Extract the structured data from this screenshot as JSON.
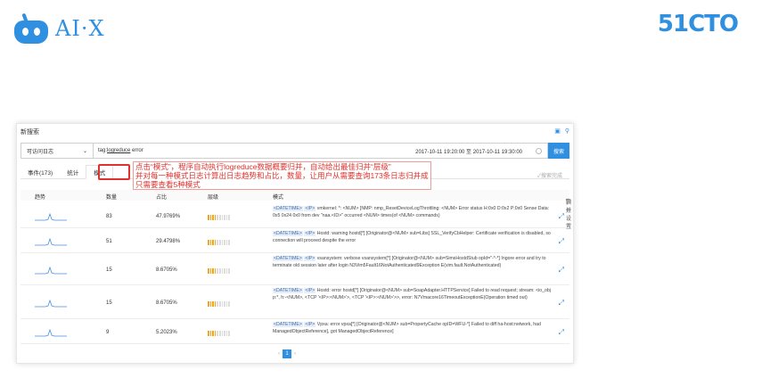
{
  "slide": {
    "brand_left": "AI·X",
    "brand_right": "51CTO"
  },
  "panel": {
    "title": "新搜索",
    "logstore_select": "可访问日志",
    "query_prefix": "tag:",
    "query_term": "logreduce",
    "query_suffix": " error",
    "time_range": "2017-10-11 19:20:00 至 2017-10-11 19:30:00",
    "search_button": "搜索",
    "tabs": [
      {
        "label": "事件(173)"
      },
      {
        "label": "统计"
      },
      {
        "label": "模式"
      }
    ],
    "search_done": "✓搜索完成",
    "annotation_lines": [
      "点击“模式”，程序自动执行logreduce数据概要归并，自动给出最佳归并“层级”",
      "并对每一种模式日志计算出日志趋势和占比，数量，让用户从需要查询173条日志归并成",
      "只需要查看5种模式"
    ],
    "columns": {
      "trend": "趋势",
      "count": "数量",
      "ratio": "占比",
      "level": "层级",
      "pattern": "模式"
    },
    "tools": {
      "settings": "归并设置",
      "expand_all": "归并",
      "back": "后退"
    },
    "rows": [
      {
        "count": "83",
        "ratio": "47.9769%",
        "level": 4,
        "p1": "<DATETIME>",
        "p2": "<IP>",
        "pattern": " vmkernel: *: <NUM> ]NMP: nmp_ResetDeviceLogThrottling: <NUM> Error status H:0x0 D:0x2 P:0x0 Sense Data: 0x5 0x24 0x0 from dev \"naa.<ID>\" occurred <NUM> times(of <NUM> commands)"
      },
      {
        "count": "51",
        "ratio": "29.4798%",
        "level": 4,
        "p1": "<DATETIME>",
        "p2": "<IP>",
        "pattern": " Hostd: warning hostd[*] [Originator@<NUM> sub=Libs] SSL_VerifyCbHelper: Certificate verification is disabled, so connection will proceed despite the error"
      },
      {
        "count": "15",
        "ratio": "8.6705%",
        "level": 4,
        "p1": "<DATETIME>",
        "p2": "<IP>",
        "pattern": " vsansystem: verbose vsansystem[*] [Originator@<NUM> sub=SimsHostdStub opId=\"-*-*] Ingore error and try to terminate old session later after login N3Vim5Fault16NotAuthenticated9Exception E(vim.fault.NotAuthenticated)"
      },
      {
        "count": "15",
        "ratio": "8.6705%",
        "level": 4,
        "p1": "<DATETIME>",
        "p2": "<IP>",
        "pattern": " Hostd: error hostd[*] [Originator@<NUM> sub=SoapAdapter.HTTPService] Failed to read request; stream: <io_obj p:*, h:-<NUM>, <TCP '<IP>:<NUM>'>, <TCP '<IP>:<NUM>'>>, error: N7Vmacore16TimeoutExceptionE(Operation timed out)"
      },
      {
        "count": "9",
        "ratio": "5.2023%",
        "level": 4,
        "p1": "<DATETIME>",
        "p2": "<IP>",
        "pattern": " Vpxa: error vpxa[*] [Originator@<NUM> sub=PropertyCache opID=WFU-*] Failed to diff ha-host:network, had ManagedObjectReference], got ManagedObjectReference]"
      }
    ],
    "pager": {
      "prev": "‹",
      "current": "1",
      "next": "›"
    }
  },
  "colors": {
    "accent": "#2f8fe0",
    "annotation": "#e0312c",
    "level_bar": "#f0a51c"
  }
}
